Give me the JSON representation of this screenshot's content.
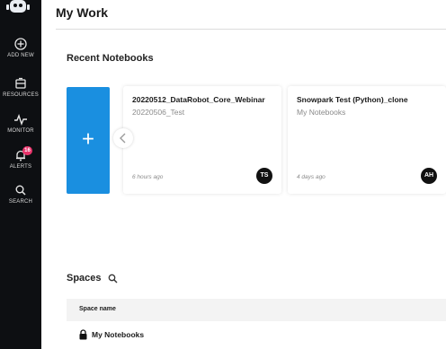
{
  "sidebar": {
    "items": [
      {
        "label": "ADD NEW",
        "icon": "plus-circle-icon"
      },
      {
        "label": "RESOURCES",
        "icon": "resources-icon"
      },
      {
        "label": "MONITOR",
        "icon": "pulse-icon"
      },
      {
        "label": "ALERTS",
        "icon": "bell-icon",
        "badge": "16"
      },
      {
        "label": "SEARCH",
        "icon": "search-icon"
      }
    ]
  },
  "header": {
    "title": "My Work"
  },
  "recent": {
    "title": "Recent Notebooks",
    "new_label": "+",
    "notebooks": [
      {
        "name": "20220512_DataRobot_Core_Webinar",
        "space": "20220506_Test",
        "time": "6 hours ago",
        "avatar": "TS"
      },
      {
        "name": "Snowpark Test (Python)_clone",
        "space": "My Notebooks",
        "time": "4 days ago",
        "avatar": "AH"
      }
    ]
  },
  "spaces": {
    "title": "Spaces",
    "column_header": "Space name",
    "rows": [
      {
        "name": "My Notebooks"
      }
    ]
  },
  "colors": {
    "accent": "#1a8fe0",
    "sidebar": "#0d0f12",
    "badge": "#e8336a"
  }
}
